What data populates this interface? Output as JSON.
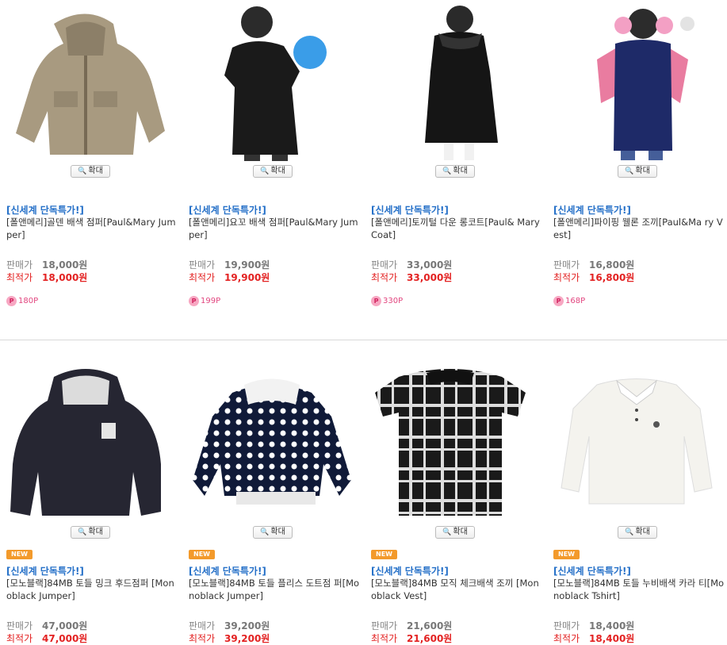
{
  "zoom_label": "확대",
  "new_badge": "NEW",
  "price_label": "판매가",
  "best_label": "최적가",
  "products": [
    {
      "promo": "[신세계 단독특가!]",
      "name": "[폴앤메리]골덴 배색 점퍼[Paul&Mary Jumper]",
      "price": "18,000원",
      "best": "18,000원",
      "points": "180P",
      "image": "beige-hooded-jacket"
    },
    {
      "promo": "[신세계 단독특가!]",
      "name": "[폴앤메리]요꼬 배색 점퍼[Paul&Mary Jumper]",
      "price": "19,900원",
      "best": "19,900원",
      "points": "199P",
      "image": "black-puffer-boy-balloon"
    },
    {
      "promo": "[신세계 단독특가!]",
      "name": "[폴앤메리]토끼털 다운 롱코트[Paul& Mary Coat]",
      "price": "33,000원",
      "best": "33,000원",
      "points": "330P",
      "image": "black-long-coat-girl"
    },
    {
      "promo": "[신세계 단독특가!]",
      "name": "[폴앤메리]파이핑 웰론 조끼[Paul&Ma ry Vest]",
      "price": "16,800원",
      "best": "16,800원",
      "points": "168P",
      "image": "navy-vest-girl"
    },
    {
      "promo": "[신세계 단독특가!]",
      "name": "[모노블랙]84MB 토들 밍크 후드점퍼 [Monoblack Jumper]",
      "price": "47,000원",
      "best": "47,000원",
      "image": "mink-hood-jumper"
    },
    {
      "promo": "[신세계 단독특가!]",
      "name": "[모노블랙]84MB 토들 플리스 도트점 퍼[Monoblack Jumper]",
      "price": "39,200원",
      "best": "39,200원",
      "image": "polka-dot-jumper"
    },
    {
      "promo": "[신세계 단독특가!]",
      "name": "[모노블랙]84MB 모직 체크배색 조끼 [Monoblack Vest]",
      "price": "21,600원",
      "best": "21,600원",
      "image": "check-wool-vest"
    },
    {
      "promo": "[신세계 단독특가!]",
      "name": "[모노블랙]84MB 토들 누비배색 카라 티[Monoblack Tshirt]",
      "price": "18,400원",
      "best": "18,400원",
      "image": "white-collar-tshirt"
    }
  ]
}
